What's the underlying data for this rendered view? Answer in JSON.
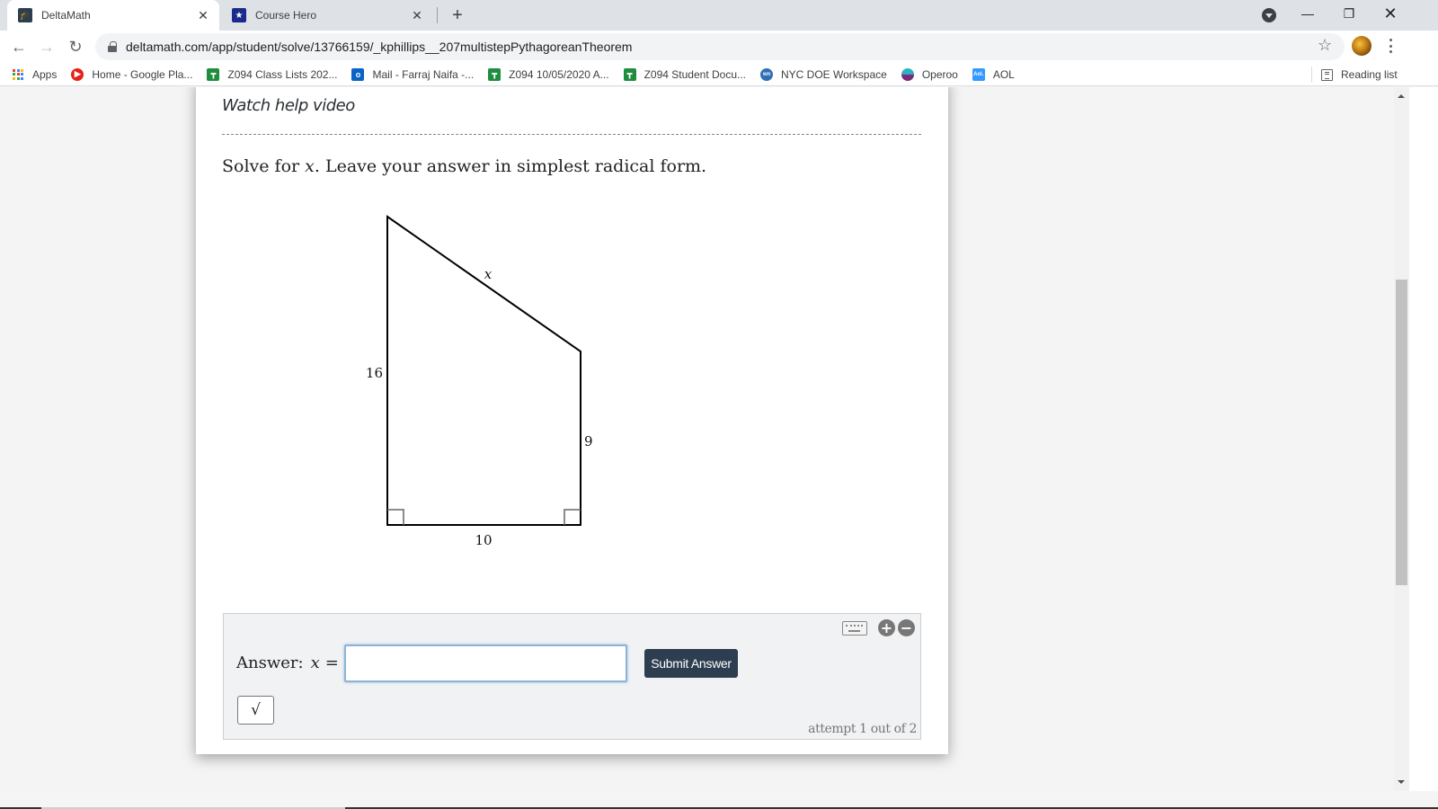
{
  "browser": {
    "tabs": [
      {
        "title": "DeltaMath",
        "active": true,
        "icon": "deltamath-icon",
        "icon_color": "#2c3e50"
      },
      {
        "title": "Course Hero",
        "active": false,
        "icon": "coursehero-icon",
        "icon_color": "#1a2a8c"
      }
    ],
    "new_tab_label": "+",
    "url": "deltamath.com/app/student/solve/13766159/_kphillips__207multistepPythagoreanTheorem",
    "bookmarks": [
      {
        "label": "Apps",
        "icon": "apps-grid-icon"
      },
      {
        "label": "Home - Google Pla...",
        "icon": "google-play-music-icon",
        "color": "#e62117"
      },
      {
        "label": "Z094 Class Lists 202...",
        "icon": "google-classroom-icon",
        "color": "#1e8e3e"
      },
      {
        "label": "Mail - Farraj Naifa -...",
        "icon": "outlook-icon",
        "color": "#0a64c8"
      },
      {
        "label": "Z094 10/05/2020 A...",
        "icon": "google-classroom-icon",
        "color": "#1e8e3e"
      },
      {
        "label": "Z094 Student Docu...",
        "icon": "google-classroom-icon",
        "color": "#1e8e3e"
      },
      {
        "label": "NYC DOE Workspace",
        "icon": "nyc-doe-icon",
        "color": "#2f6fb5"
      },
      {
        "label": "Operoo",
        "icon": "operoo-icon",
        "color": "#7b2a7a"
      },
      {
        "label": "AOL",
        "icon": "aol-icon",
        "color": "#39f"
      }
    ],
    "reading_list": "Reading list"
  },
  "page": {
    "help_video": "Watch help video",
    "prompt": {
      "before": "Solve for ",
      "variable": "x",
      "after": ". Leave your answer in simplest radical form."
    },
    "figure": {
      "shape": "right trapezoid",
      "left_side": "16",
      "right_side": "9",
      "bottom_side": "10",
      "slanted_side": "x",
      "right_angles": [
        "bottom-left",
        "bottom-right"
      ]
    },
    "answer": {
      "label": "Answer:",
      "variable": "x",
      "equals": "=",
      "value": "",
      "placeholder": "",
      "submit_label": "Submit Answer",
      "sqrt_label": "√",
      "attempt_text": "attempt 1 out of 2"
    }
  }
}
